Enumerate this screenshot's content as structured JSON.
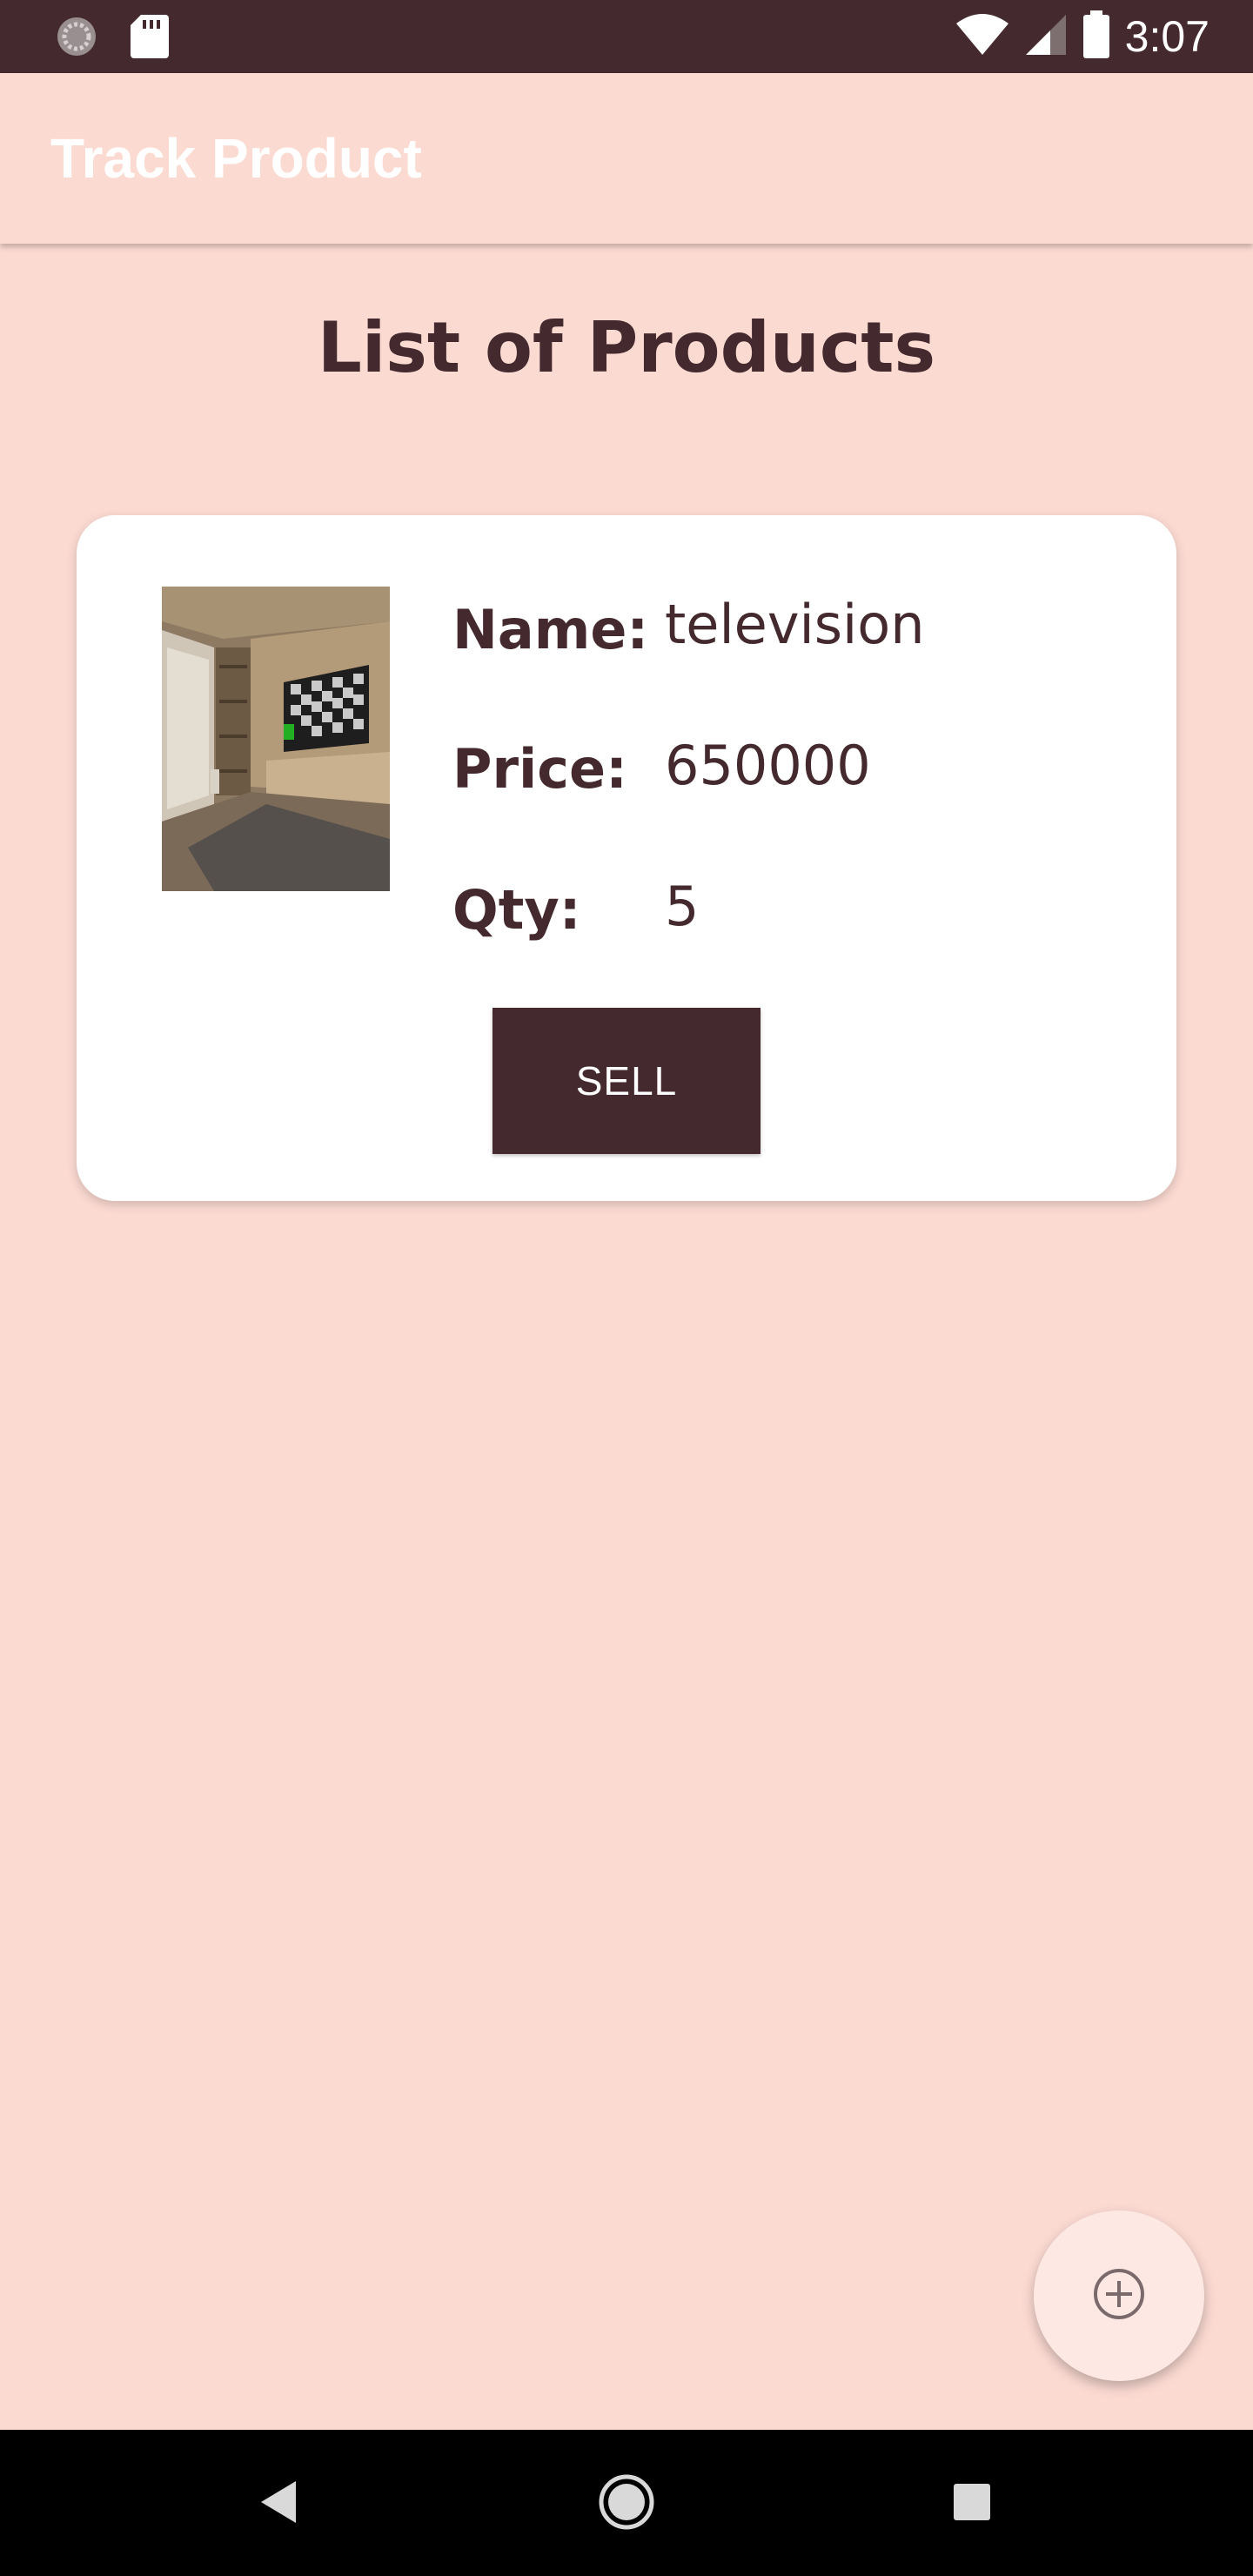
{
  "status_bar": {
    "time": "3:07",
    "left_icons": [
      "sync-icon",
      "sd-card-icon"
    ],
    "right_icons": [
      "wifi-icon",
      "signal-icon",
      "battery-icon"
    ]
  },
  "app_bar": {
    "title": "Track Product"
  },
  "page": {
    "heading": "List of Products"
  },
  "products": [
    {
      "name_label": "Name:",
      "name": "television",
      "price_label": "Price:",
      "price": "650000",
      "qty_label": "Qty:",
      "qty": "5",
      "sell_label": "SELL"
    }
  ],
  "fab": {
    "icon": "add-circle-icon"
  },
  "nav_bar": {
    "icons": [
      "back-icon",
      "home-icon",
      "recents-icon"
    ]
  },
  "colors": {
    "primary_dark": "#442a2e",
    "background": "#fbdad2",
    "card": "#ffffff",
    "fab": "#fde8e3"
  }
}
